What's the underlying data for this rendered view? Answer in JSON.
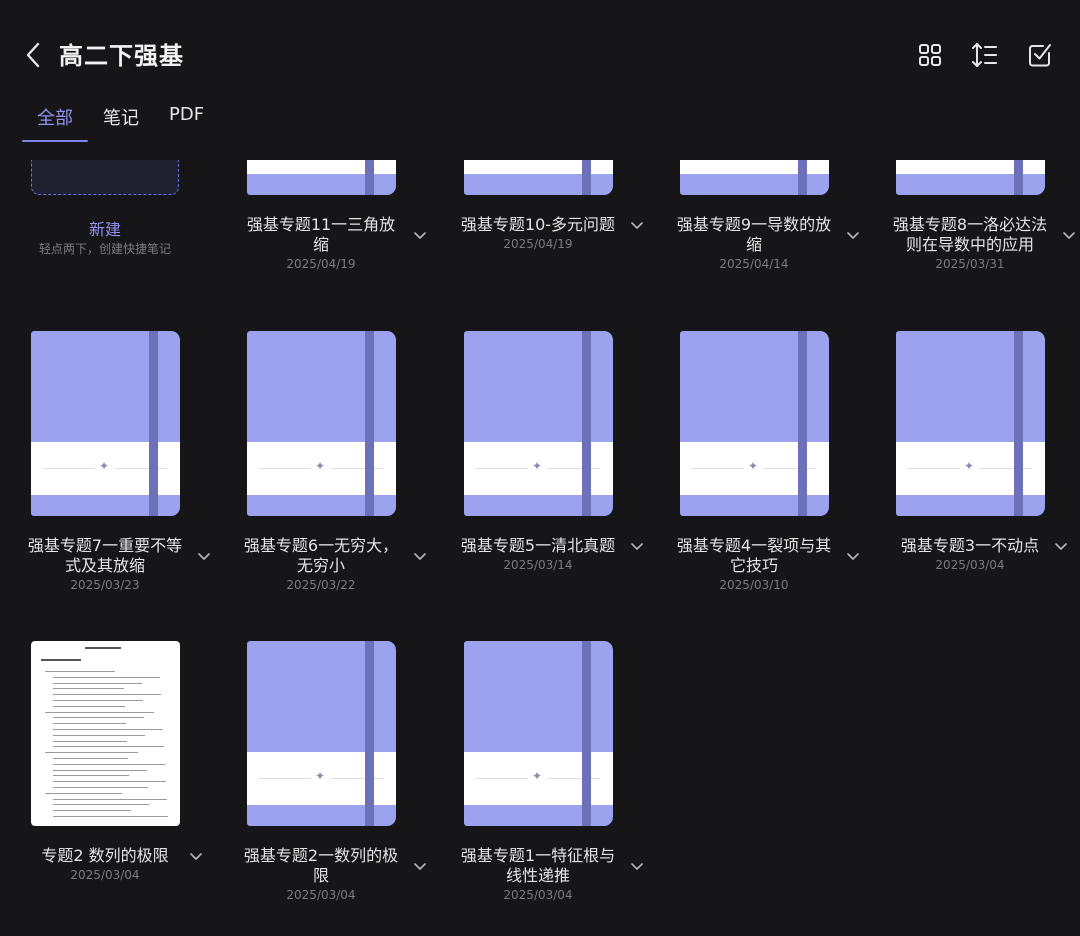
{
  "header": {
    "title": "高二下强基"
  },
  "tabs": [
    {
      "label": "全部",
      "active": true
    },
    {
      "label": "笔记",
      "active": false
    },
    {
      "label": "PDF",
      "active": false
    }
  ],
  "toolbar_icons": [
    "grid-view-icon",
    "sort-icon",
    "select-check-icon"
  ],
  "new_note": {
    "label": "新建",
    "hint": "轻点两下，创建快捷笔记"
  },
  "notebooks": [
    {
      "title": [
        "强基专题11一三角放",
        "缩"
      ],
      "date": "2025/04/19",
      "cover": "notebook"
    },
    {
      "title": [
        "强基专题10-多元问题"
      ],
      "date": "2025/04/19",
      "cover": "notebook"
    },
    {
      "title": [
        "强基专题9一导数的放",
        "缩"
      ],
      "date": "2025/04/14",
      "cover": "notebook"
    },
    {
      "title": [
        "强基专题8一洛必达法",
        "则在导数中的应用"
      ],
      "date": "2025/03/31",
      "cover": "notebook"
    },
    {
      "title": [
        "强基专题7一重要不等",
        "式及其放缩"
      ],
      "date": "2025/03/23",
      "cover": "notebook"
    },
    {
      "title": [
        "强基专题6一无穷大，",
        "无穷小"
      ],
      "date": "2025/03/22",
      "cover": "notebook"
    },
    {
      "title": [
        "强基专题5一清北真题"
      ],
      "date": "2025/03/14",
      "cover": "notebook"
    },
    {
      "title": [
        "强基专题4一裂项与其",
        "它技巧"
      ],
      "date": "2025/03/10",
      "cover": "notebook"
    },
    {
      "title": [
        "强基专题3一不动点"
      ],
      "date": "2025/03/04",
      "cover": "notebook"
    },
    {
      "title": [
        "专题2 数列的极限"
      ],
      "date": "2025/03/04",
      "cover": "pdf"
    },
    {
      "title": [
        "强基专题2一数列的极",
        "限"
      ],
      "date": "2025/03/04",
      "cover": "notebook"
    },
    {
      "title": [
        "强基专题1一特征根与",
        "线性递推"
      ],
      "date": "2025/03/04",
      "cover": "notebook"
    }
  ],
  "colors": {
    "background": "#161618",
    "accent": "#8f93f2",
    "notebook_cover": "#9da2ef",
    "notebook_strap": "#6d72b8"
  }
}
